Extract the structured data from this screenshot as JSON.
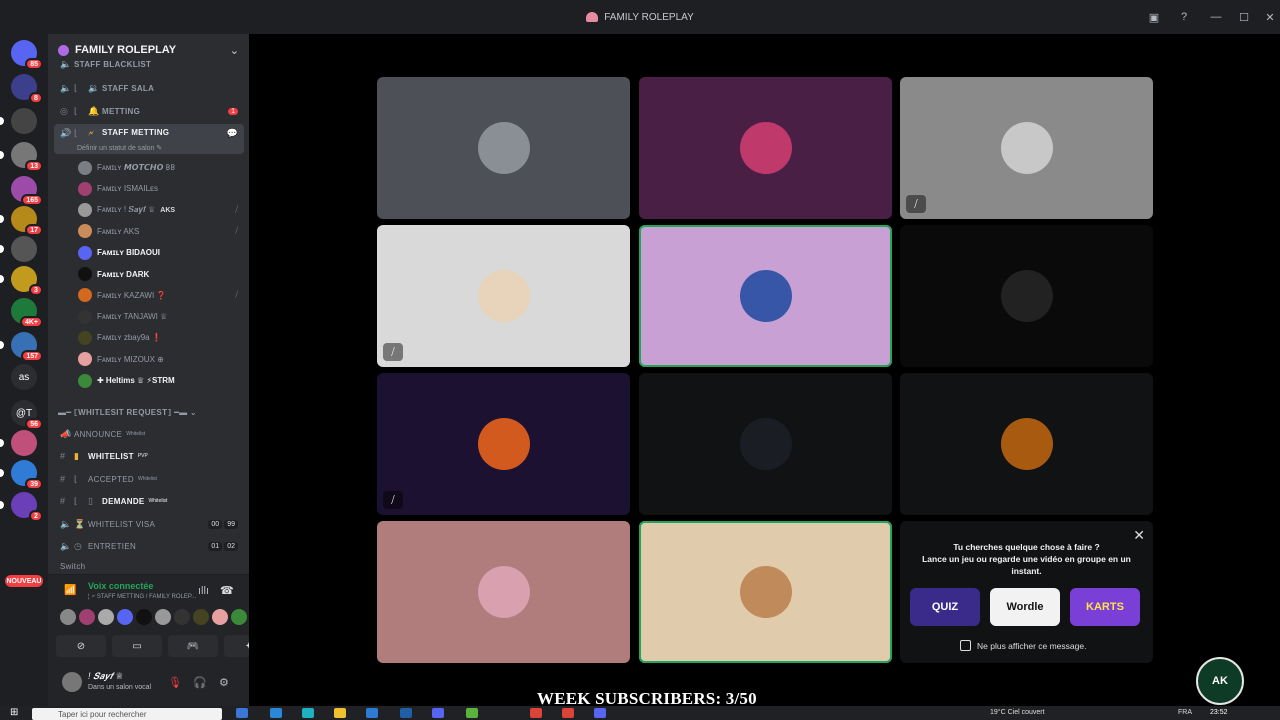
{
  "window": {
    "title": "FAMILY ROLEPLAY"
  },
  "server": {
    "name": "FAMILY ROLEPLAY"
  },
  "guilds": [
    {
      "badge": "85",
      "color": "#5865f2"
    },
    {
      "badge": "8",
      "color": "#3b3f8c"
    },
    {
      "badge": "",
      "color": "#444"
    },
    {
      "badge": "13",
      "color": "#777"
    },
    {
      "badge": "165",
      "color": "#9c4ca8"
    },
    {
      "badge": "17",
      "color": "#b58a1a"
    },
    {
      "badge": "",
      "color": "#555"
    },
    {
      "badge": "3",
      "color": "#c29a1e"
    },
    {
      "badge": "4K+",
      "color": "#1d7a3b"
    },
    {
      "badge": "157",
      "color": "#3870b5"
    },
    {
      "badge": "",
      "label": "as",
      "color": "#2b2d31"
    },
    {
      "badge": "56",
      "label": "@T",
      "color": "#2b2d31"
    },
    {
      "badge": "",
      "color": "#c04f7a"
    },
    {
      "badge": "39",
      "color": "#2f7bd6"
    },
    {
      "badge": "2",
      "color": "#6a3fb8"
    }
  ],
  "guild_new_label": "NOUVEAU",
  "channels": {
    "staff_blacklist": "STAFF BLACKLIST",
    "staff_sala": "STAFF SALA",
    "metting": "METTING",
    "metting_badge": "1",
    "staff_metting": "STAFF METTING",
    "status_prompt": "Définir un statut de salon",
    "category": "⟦WHITLESIT REQUEST⟧",
    "announce": "ANNOUNCE",
    "announce_sup": "Whitelist",
    "whitelist": "WHITELIST",
    "whitelist_sup": "PVP",
    "accepted": "ACCEPTED",
    "accepted_sup": "Whitelist",
    "demande": "DEMANDE",
    "demande_sup": "Whitelist",
    "whitelist_visa": "WHITELIST VISA",
    "visa_count": "00",
    "visa_limit": "99",
    "entretien": "ENTRETIEN",
    "entretien_count": "01",
    "entretien_limit": "02",
    "switch_partial": "Switch"
  },
  "members": [
    {
      "name": "Fᴀᴍɪʟʏ 𝙈𝙊𝙏𝘾𝙃𝙊 𐌁𐌁",
      "bold": false,
      "color": "#7a7f86"
    },
    {
      "name": "Fᴀᴍɪʟʏ ISMAILᴇs",
      "bold": false,
      "color": "#a04070"
    },
    {
      "name": "Fᴀᴍɪʟʏ ! 𝑺𝒂𝒚𝒇 ♕",
      "bold": false,
      "tag": "AKS",
      "color": "#999"
    },
    {
      "name": "Fᴀᴍɪʟʏ AKS",
      "bold": false,
      "color": "#c98b5a"
    },
    {
      "name": "Fᴀᴍɪʟʏ BIDAOUI",
      "bold": true,
      "color": "#5865f2"
    },
    {
      "name": "Fᴀᴍɪʟʏ DARK",
      "bold": true,
      "color": "#111"
    },
    {
      "name": "Fᴀᴍɪʟʏ KAZAWI ❓",
      "bold": false,
      "color": "#d2691e"
    },
    {
      "name": "Fᴀᴍɪʟʏ TANJAWI ♕",
      "bold": false,
      "color": "#333"
    },
    {
      "name": "Fᴀᴍɪʟʏ zbay9a ❗",
      "bold": false,
      "color": "#442"
    },
    {
      "name": "Fᴀᴍɪʟʏ MIZOUX ⊕",
      "bold": false,
      "color": "#e6a0a0"
    },
    {
      "name": "✚ Heltims ♕ ⚡STRM",
      "bold": true,
      "color": "#3a8a3a"
    }
  ],
  "voice": {
    "title": "Voix connectée",
    "subtitle": "¦ 🗲 STAFF METTING / FAMILY ROLEP...",
    "avatars": [
      "#888",
      "#a04070",
      "#aaa",
      "#5865f2",
      "#111",
      "#999",
      "#333",
      "#442",
      "#e6a0a0",
      "#3a8a3a"
    ]
  },
  "user": {
    "name": "! 𝑺𝒂𝒚𝒇 ♕",
    "status": "Dans un salon vocal"
  },
  "tiles": [
    {
      "bg": "#4e5058",
      "av": "#8a8f96",
      "speaking": false,
      "muted": false
    },
    {
      "bg": "#4a1f45",
      "av": "#c0396b",
      "speaking": false,
      "muted": false
    },
    {
      "bg": "#8a8a8a",
      "av": "#c8c8c8",
      "speaking": false,
      "muted": true
    },
    {
      "bg": "#d9d9d9",
      "av": "#e8d3bb",
      "speaking": false,
      "muted": true
    },
    {
      "bg": "#c8a0d4",
      "av": "#3756a8",
      "speaking": true,
      "muted": false
    },
    {
      "bg": "#0a0a0b",
      "av": "#222",
      "speaking": false,
      "muted": false
    },
    {
      "bg": "#1c1130",
      "av": "#d25a1e",
      "speaking": false,
      "muted": true
    },
    {
      "bg": "#111214",
      "av": "#1a1d24",
      "speaking": false,
      "muted": false
    },
    {
      "bg": "#111214",
      "av": "#a85a10",
      "speaking": false,
      "muted": false
    },
    {
      "bg": "#b07c7c",
      "av": "#d9a0b0",
      "speaking": false,
      "muted": false
    },
    {
      "bg": "#e0ccac",
      "av": "#c08a5a",
      "speaking": true,
      "muted": false
    }
  ],
  "activity": {
    "text_line1": "Tu cherches quelque chose à faire ?",
    "text_line2": "Lance un jeu ou regarde une vidéo en groupe en un instant.",
    "cards": [
      {
        "label": "QUIZ",
        "bg": "#3a2a8a",
        "fg": "#ffffff"
      },
      {
        "label": "Wordle",
        "bg": "#f2f2f2",
        "fg": "#111111"
      },
      {
        "label": "KARTS",
        "bg": "#7a3fd6",
        "fg": "#ffe24a"
      }
    ],
    "dont_show": "Ne plus afficher ce message."
  },
  "overlay": "WEEK SUBSCRIBERS: 3/50",
  "ak_logo": "AK",
  "taskbar": {
    "search_placeholder": "Taper ici pour rechercher",
    "weather": "19°C  Ciel couvert",
    "lang": "FRA",
    "clock": "23:52"
  }
}
